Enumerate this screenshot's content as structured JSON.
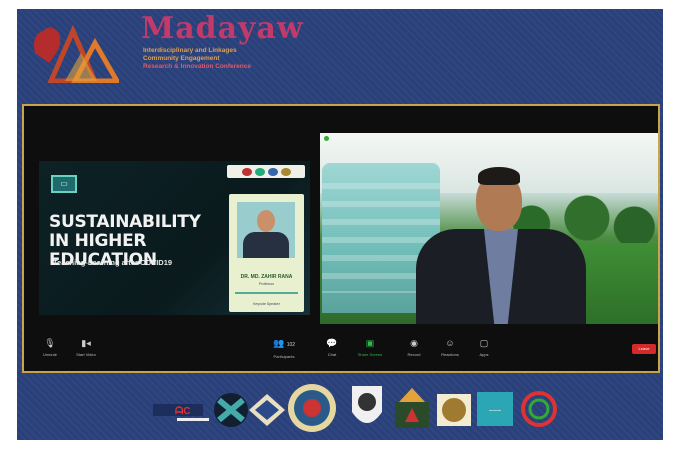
{
  "header": {
    "title": "Madayaw",
    "subtitle_lines": [
      "Interdisciplinary and Linkages",
      "Community Engagement",
      "Research & Innovation Conference"
    ]
  },
  "slide": {
    "title": "SUSTAINABILITY IN HIGHER EDUCATION",
    "subtitle": "Teaching-Learning after COVID19",
    "speaker_name": "DR. MD. ZAHIR RANA",
    "speaker_role": "Professor",
    "card_footer": "Keynote Speaker"
  },
  "toolbar": {
    "buttons": [
      {
        "label": "Unmute",
        "icon": "microphone-icon"
      },
      {
        "label": "Start Video",
        "icon": "video-camera-icon"
      },
      {
        "label": "Participants",
        "icon": "participants-icon"
      },
      {
        "label": "Chat",
        "icon": "chat-icon"
      },
      {
        "label": "Share Screen",
        "icon": "share-screen-icon"
      },
      {
        "label": "Record",
        "icon": "record-icon"
      },
      {
        "label": "Reactions",
        "icon": "reactions-icon"
      },
      {
        "label": "Apps",
        "icon": "apps-icon"
      }
    ],
    "participant_count": "102",
    "end_label": "Leave"
  },
  "colors": {
    "background": "#29407a",
    "frame_border": "#c9a44a",
    "brand": "#c23a6a",
    "share_green": "#2dbb4c",
    "end_red": "#d42a2a"
  }
}
